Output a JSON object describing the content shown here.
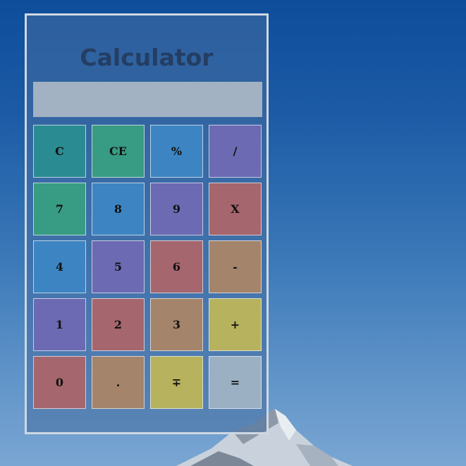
{
  "app": {
    "title": "Calculator"
  },
  "display": {
    "value": ""
  },
  "keys": [
    {
      "label": "C",
      "name": "clear-button"
    },
    {
      "label": "CE",
      "name": "clear-entry-button"
    },
    {
      "label": "%",
      "name": "percent-button"
    },
    {
      "label": "/",
      "name": "divide-button"
    },
    {
      "label": "7",
      "name": "digit-7-button"
    },
    {
      "label": "8",
      "name": "digit-8-button"
    },
    {
      "label": "9",
      "name": "digit-9-button"
    },
    {
      "label": "X",
      "name": "multiply-button"
    },
    {
      "label": "4",
      "name": "digit-4-button"
    },
    {
      "label": "5",
      "name": "digit-5-button"
    },
    {
      "label": "6",
      "name": "digit-6-button"
    },
    {
      "label": "-",
      "name": "subtract-button"
    },
    {
      "label": "1",
      "name": "digit-1-button"
    },
    {
      "label": "2",
      "name": "digit-2-button"
    },
    {
      "label": "3",
      "name": "digit-3-button"
    },
    {
      "label": "+",
      "name": "add-button"
    },
    {
      "label": "0",
      "name": "digit-0-button"
    },
    {
      "label": ".",
      "name": "decimal-button"
    },
    {
      "label": "∓",
      "name": "sign-toggle-button"
    },
    {
      "label": "=",
      "name": "equals-button"
    }
  ],
  "colors": {
    "title": "#243e63",
    "display": "#a3b2c2",
    "panel_border": "#cfd8e3"
  }
}
